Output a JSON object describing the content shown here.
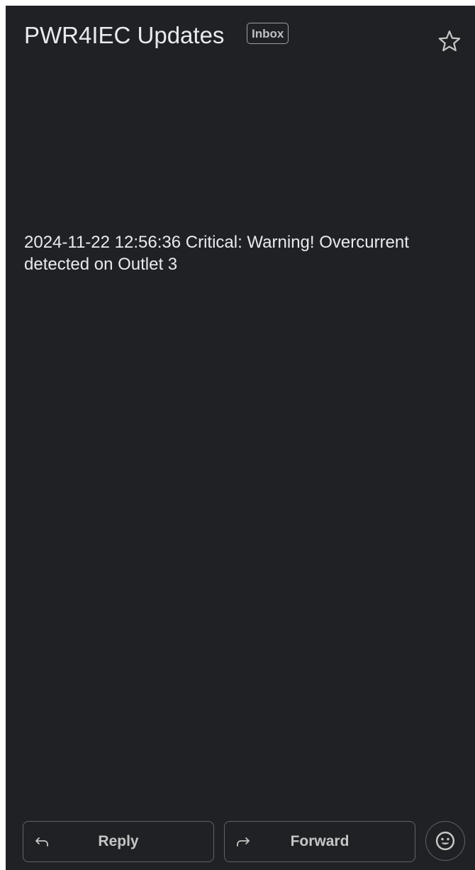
{
  "header": {
    "subject": "PWR4IEC Updates",
    "label": "Inbox",
    "star_icon": "star-outline-icon"
  },
  "message": {
    "body": "2024-11-22 12:56:36 Critical: Warning! Overcurrent detected on Outlet 3"
  },
  "actions": {
    "reply_label": "Reply",
    "reply_icon": "reply-arrow-icon",
    "forward_label": "Forward",
    "forward_icon": "forward-arrow-icon",
    "emoji_icon": "smiley-face-icon"
  },
  "colors": {
    "background": "#202124",
    "text": "#e8eaed",
    "border": "#5f6368"
  }
}
